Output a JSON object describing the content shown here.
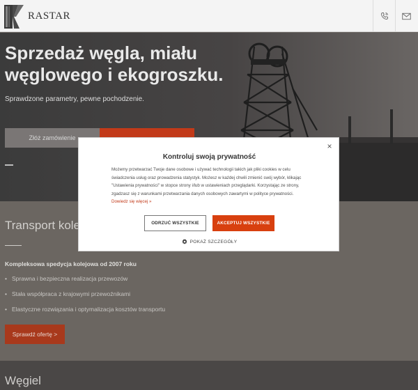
{
  "header": {
    "logo_text": "RASTAR"
  },
  "hero": {
    "title": "Sprzedaż węgla, miału węglowego i ekogroszku.",
    "subtitle": "Sprawdzone parametry, pewne pochodzenie.",
    "order_button": "Złóż zamówienie"
  },
  "transport": {
    "title": "Transport kolejowy",
    "lead": "Kompleksowa spedycja kolejowa od 2007 roku",
    "items": [
      "Sprawna i bezpieczna realizacja przewozów",
      "Stała współpraca z krajowymi przewoźnikami",
      "Elastyczne rozwiązania i optymalizacja kosztów transportu"
    ],
    "button": "Sprawdź ofertę >"
  },
  "coal": {
    "title": "Węgiel"
  },
  "cookie_modal": {
    "title": "Kontroluj swoją prywatność",
    "text": "Możemy przetwarzać Twoje dane osobowe i używać technologii takich jak pliki cookies w celu świadczenia usług oraz prowadzenia statystyk. Możesz w każdej chwili zmienić swój wybór, klikając \"Ustawienia prywatności\" w stopce strony i/lub w ustawieniach przeglądarki. Korzystając ze strony, zgadzasz się z warunkami przetwarzania danych osobowych zawartymi w polityce prywatności.",
    "link": "Dowiedz się więcej »",
    "reject_button": "ODRZUĆ WSZYSTKIE",
    "accept_button": "AKCEPTUJ WSZYSTKIE",
    "details": "POKAŻ SZCZEGÓŁY",
    "close": "×"
  },
  "colors": {
    "accent": "#d8400f",
    "header_bg": "#f4f4f4",
    "section_bg": "#6b6661"
  }
}
